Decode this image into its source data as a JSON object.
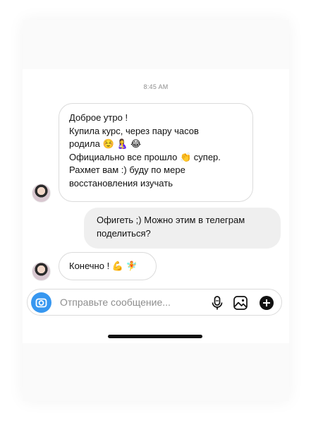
{
  "timestamp": "8:45 AM",
  "messages": [
    {
      "direction": "incoming",
      "text": "Доброе утро !\nКупила курс, через пару часов\nродила ☺️ 🤱 😂\nОфициально все прошло 👏 супер.\nРахмет вам :) буду по мере\nвосстановления изучать"
    },
    {
      "direction": "outgoing",
      "text": "Офигеть ;) Можно этим в телеграм\nподелиться?"
    },
    {
      "direction": "incoming",
      "text": "Конечно ! 💪 🧚"
    }
  ],
  "composer": {
    "placeholder": "Отправьте сообщение...",
    "icons": [
      "camera-icon",
      "microphone-icon",
      "gallery-icon",
      "plus-icon"
    ]
  },
  "colors": {
    "accent": "#3797f0",
    "outgoing_bubble": "#efefef",
    "border": "#dbdbdb"
  }
}
